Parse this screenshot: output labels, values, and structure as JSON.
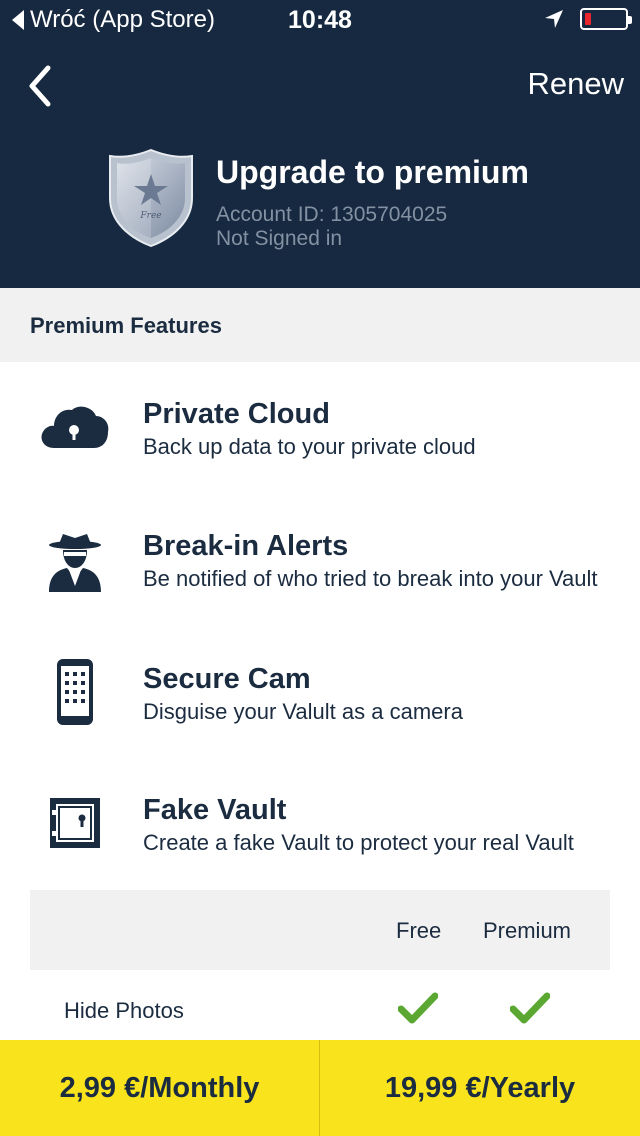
{
  "status_bar": {
    "back_label": "Wróć (App Store)",
    "time": "10:48",
    "battery_level": 0.15,
    "battery_color": "#e8262b"
  },
  "header": {
    "renew_label": "Renew",
    "title": "Upgrade to premium",
    "account_id": "Account ID: 1305704025",
    "sign_status": "Not Signed in",
    "badge_text": "Free",
    "background_color": "#162940"
  },
  "section": {
    "label": "Premium Features"
  },
  "features": [
    {
      "icon": "cloud-lock-icon",
      "title": "Private Cloud",
      "description": "Back up data to your private cloud"
    },
    {
      "icon": "spy-icon",
      "title": "Break-in Alerts",
      "description": "Be notified of who tried to break into your Vault"
    },
    {
      "icon": "phone-keypad-icon",
      "title": "Secure Cam",
      "description": "Disguise your Valult as a camera"
    },
    {
      "icon": "safe-icon",
      "title": "Fake Vault",
      "description": "Create a fake Vault to protect your real Vault"
    }
  ],
  "comparison": {
    "columns": [
      "Free",
      "Premium"
    ],
    "rows": [
      {
        "label": "Hide Photos",
        "free": true,
        "premium": true
      }
    ],
    "check_color": "#5aa832"
  },
  "purchase": {
    "monthly_label": "2,99 €/Monthly",
    "yearly_label": "19,99 €/Yearly",
    "button_color": "#f8e31c"
  }
}
